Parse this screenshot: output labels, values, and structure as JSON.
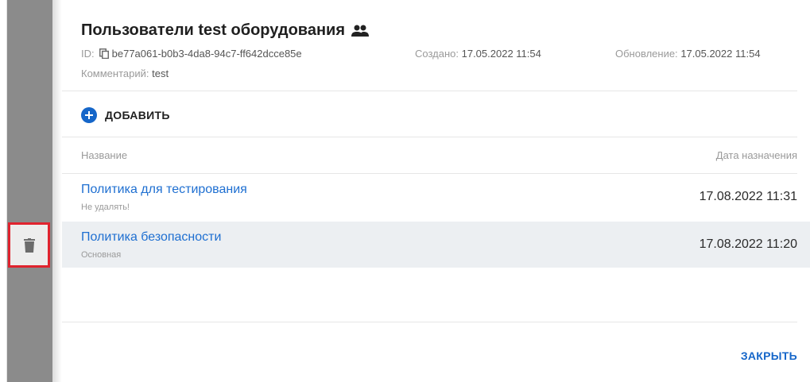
{
  "dialog": {
    "title": "Пользователи test оборудования",
    "title_icon": "users-icon",
    "id_label": "ID:",
    "id_value": "be77a061-b0b3-4da8-94c7-ff642dcce85e",
    "created_label": "Создано:",
    "created_value": "17.05.2022 11:54",
    "updated_label": "Обновление:",
    "updated_value": "17.05.2022 11:54",
    "comment_label": "Комментарий:",
    "comment_value": "test",
    "add_label": "ДОБАВИТЬ",
    "close_label": "ЗАКРЫТЬ"
  },
  "table": {
    "columns": [
      "Название",
      "Дата назначения"
    ],
    "rows": [
      {
        "name": "Политика для тестирования",
        "subtitle": "Не удалять!",
        "date": "17.08.2022 11:31"
      },
      {
        "name": "Политика безопасности",
        "subtitle": "Основная",
        "date": "17.08.2022 11:20"
      }
    ]
  },
  "colors": {
    "accent": "#1566c9",
    "link": "#1e6fd1",
    "highlight_border": "#e0232e",
    "selected_row": "#eceff2"
  }
}
